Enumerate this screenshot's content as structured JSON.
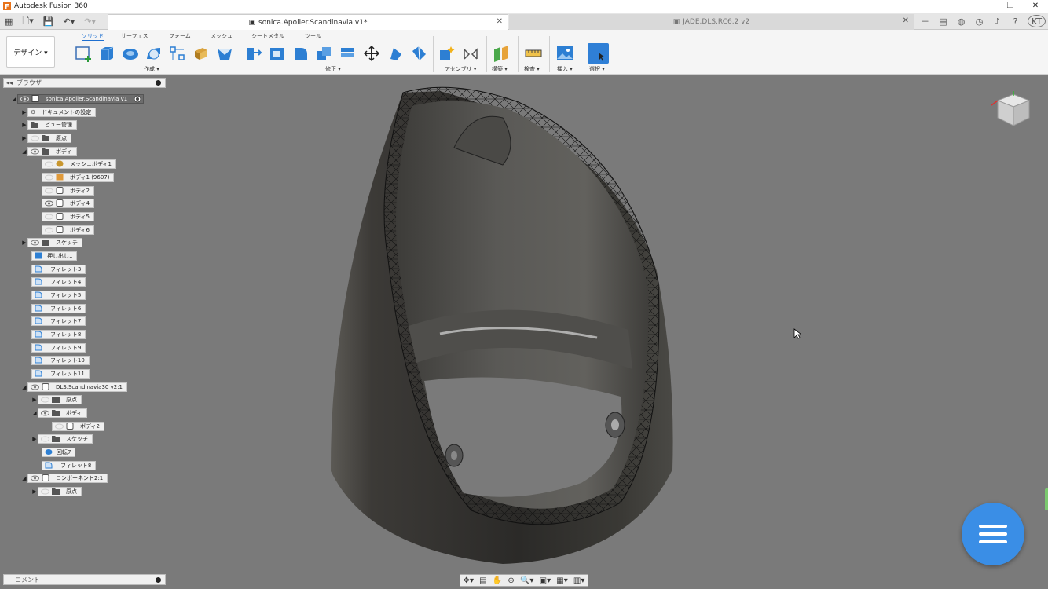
{
  "app": {
    "title": "Autodesk Fusion 360",
    "logo_letter": "F"
  },
  "window": {
    "minimize": "─",
    "restore": "❐",
    "close": "✕"
  },
  "tabs": [
    {
      "label": "sonica.Apoller.Scandinavia v1*",
      "active": true
    },
    {
      "label": "JADE.DLS.RC6.2 v2",
      "active": false
    }
  ],
  "user": {
    "initials": "KT"
  },
  "workspace": {
    "label": "デザイン ▾"
  },
  "toolbar_tabs": [
    "ソリッド",
    "サーフェス",
    "フォーム",
    "メッシュ",
    "シートメタル",
    "ツール"
  ],
  "groups": {
    "create": "作成 ▾",
    "modify": "修正 ▾",
    "assemble": "アセンブリ ▾",
    "construct": "構築 ▾",
    "inspect": "検査 ▾",
    "insert": "挿入 ▾",
    "select": "選択 ▾"
  },
  "browser": {
    "title": "ブラウザ",
    "items": [
      {
        "label": "sonica.Apoller.Scandinavia v1"
      },
      {
        "label": "ドキュメントの設定"
      },
      {
        "label": "ビュー管理"
      },
      {
        "label": "原点"
      },
      {
        "label": "ボディ"
      },
      {
        "label": "メッシュボディ1"
      },
      {
        "label": "ボディ1 (9607)"
      },
      {
        "label": "ボディ2"
      },
      {
        "label": "ボディ4"
      },
      {
        "label": "ボディ5"
      },
      {
        "label": "ボディ6"
      },
      {
        "label": "スケッチ"
      },
      {
        "label": "押し出し1"
      },
      {
        "label": "フィレット3"
      },
      {
        "label": "フィレット4"
      },
      {
        "label": "フィレット5"
      },
      {
        "label": "フィレット6"
      },
      {
        "label": "フィレット7"
      },
      {
        "label": "フィレット8"
      },
      {
        "label": "フィレット9"
      },
      {
        "label": "フィレット10"
      },
      {
        "label": "フィレット11"
      },
      {
        "label": "DLS.Scandinavia30 v2:1"
      },
      {
        "label": "原点"
      },
      {
        "label": "ボディ"
      },
      {
        "label": "ボディ2"
      },
      {
        "label": "スケッチ"
      },
      {
        "label": "回転7"
      },
      {
        "label": "フィレット8"
      },
      {
        "label": "コンポーネント2:1"
      },
      {
        "label": "原点"
      }
    ]
  },
  "comments": {
    "label": "コメント"
  },
  "colors": {
    "accent": "#1e6fd0",
    "fab": "#3a8ee6",
    "canvas": "#7a7a7a"
  }
}
